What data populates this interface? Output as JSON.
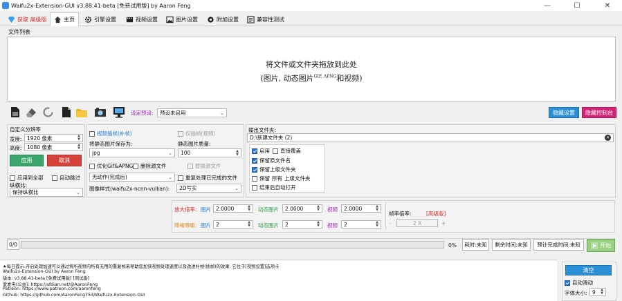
{
  "window": {
    "title": "Waifu2x-Extension-GUI v3.88.41-beta [免费试用版] by Aaron Feng",
    "minimize_glyph": "—",
    "maximize_glyph": "☐",
    "close_glyph": "✕"
  },
  "tabs": [
    {
      "label": "获取 高级版",
      "icon": "diamond-icon"
    },
    {
      "label": "主页",
      "icon": "home-icon"
    },
    {
      "label": "引擎设置",
      "icon": "gear-icon"
    },
    {
      "label": "视频设置",
      "icon": "film-icon"
    },
    {
      "label": "图片设置",
      "icon": "image-icon"
    },
    {
      "label": "附加设置",
      "icon": "cog-plus-icon"
    },
    {
      "label": "兼容性测试",
      "icon": "test-icon"
    }
  ],
  "file_list": {
    "group_label": "文件列表",
    "drop_line1": "将文件或文件夹拖放到此处",
    "drop_line2_a": "(图片, 动态图片",
    "drop_line2_sup": "GIF, APNG",
    "drop_line2_b": "和视频)"
  },
  "toolbar": {
    "preset_label": "设定预设:",
    "preset_value": "预设未启用",
    "hide_settings": "隐藏设置",
    "hide_console": "隐藏控制台"
  },
  "custom_res": {
    "title": "自定义分辨率",
    "width_label": "宽度:",
    "width_value": "1920 像素",
    "height_label": "高度:",
    "height_value": "1080 像素",
    "apply": "应用",
    "cancel": "取消",
    "apply_all": "应用到全部",
    "auto_skip": "自动跳过",
    "aspect_label": "纵横比:",
    "aspect_value": "保持纵横比"
  },
  "mid": {
    "video_interp": "视频插帧(补帧)",
    "only_interp": "仅插帧(视频)",
    "save_as_label": "将静态图片保存为:",
    "save_format": "jpg",
    "quality_label": "静态图片质量:",
    "quality_value": "100",
    "optimize_gif": "优化Gif&APNG",
    "delete_source": "删除源文件",
    "replace_source": "替换源文件",
    "action_value": "无动作(完成后)",
    "reprocess": "重复处理已完成的文件",
    "style_label": "图像样式(waifu2x-ncnn-vulkan):",
    "style_value": "2D写实"
  },
  "output": {
    "label": "输出文件夹:",
    "path": "D:\\新建文件夹 (2)",
    "enable": "启用",
    "overwrite": "直接覆盖",
    "keep_name": "保留原文件名",
    "keep_parent": "保留上级文件夹",
    "keep_all_a": "保留",
    "keep_all_b": "所有",
    "keep_all_c": "上级文件夹",
    "open_after": "结束后自动打开"
  },
  "scale": {
    "scale_label": "放大倍率:",
    "denoise_label": "降噪等级:",
    "image": "图片",
    "animated": "动态图片",
    "video": "视频",
    "scale_image": "2.0000",
    "scale_animated": "2.0000",
    "scale_video": "2.0000",
    "denoise_image": "2",
    "denoise_animated": "2",
    "denoise_video": "2",
    "fps_label": "帧率倍率:",
    "fps_adv": "[高级版]",
    "fps_minus": "-",
    "fps_value": "2 X",
    "fps_plus": "+"
  },
  "progress": {
    "count": "0/0",
    "percent": "0%",
    "elapsed": "耗时:未知",
    "remaining": "剩余时间:未知",
    "eta": "预计完成时间:未知",
    "start": "开始"
  },
  "log": {
    "lines": [
      "★每日提示:开启处理加速可以通过将所视频内所有无用的重复帧来帮助您加快视频处理速度以及改进补帧(插帧)的效果. 它位于[视频设置]选项卡",
      "Waifu2x-Extension-GUI by Aaron Feng",
      "版本: v3.88.41-beta [免费试用版] [测试版]",
      "爱发电(公益): https://afdian.net/@AaronFeng",
      "Patreon: https://www.patreon.com/aaronfeng",
      "Github: https://github.com/AaronFeng753/Waifu2x-Extension-GUI"
    ]
  },
  "right_panel": {
    "clear": "清空",
    "auto_scroll": "自动滑动",
    "font_size_label": "字体大小:",
    "font_size_value": "9"
  }
}
